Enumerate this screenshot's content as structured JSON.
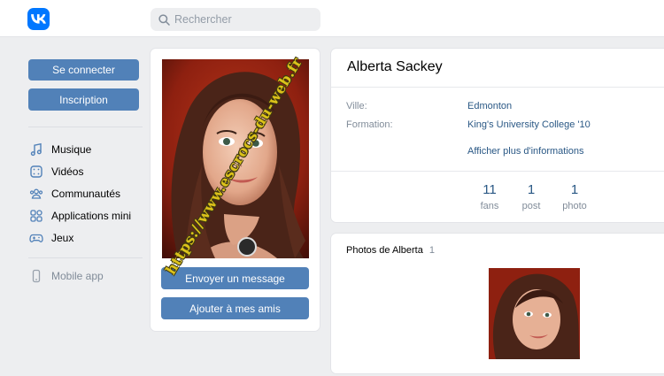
{
  "header": {
    "search": {
      "placeholder": "Rechercher"
    }
  },
  "sidebar": {
    "login_label": "Se connecter",
    "register_label": "Inscription",
    "items": [
      {
        "label": "Musique",
        "icon": "music-note-icon"
      },
      {
        "label": "Vidéos",
        "icon": "video-icon"
      },
      {
        "label": "Communautés",
        "icon": "community-icon"
      },
      {
        "label": "Applications mini",
        "icon": "apps-grid-icon"
      },
      {
        "label": "Jeux",
        "icon": "gamepad-icon"
      }
    ],
    "mobile_label": "Mobile app"
  },
  "profile": {
    "name": "Alberta Sackey",
    "message_label": "Envoyer un message",
    "add_friend_label": "Ajouter à mes amis",
    "info": [
      {
        "label": "Ville:",
        "value": "Edmonton"
      },
      {
        "label": "Formation:",
        "value": "King's University College '10"
      }
    ],
    "more_info_label": "Afficher plus d'informations",
    "stats": [
      {
        "value": "11",
        "label": "fans"
      },
      {
        "value": "1",
        "label": "post"
      },
      {
        "value": "1",
        "label": "photo"
      }
    ]
  },
  "photos": {
    "title": "Photos de Alberta",
    "count": "1"
  },
  "watermark": "https://www.escrocs-du-web.fr",
  "colors": {
    "brand": "#0077ff",
    "button": "#5181b8",
    "link": "#2a5885",
    "page_bg": "#edeef0"
  }
}
